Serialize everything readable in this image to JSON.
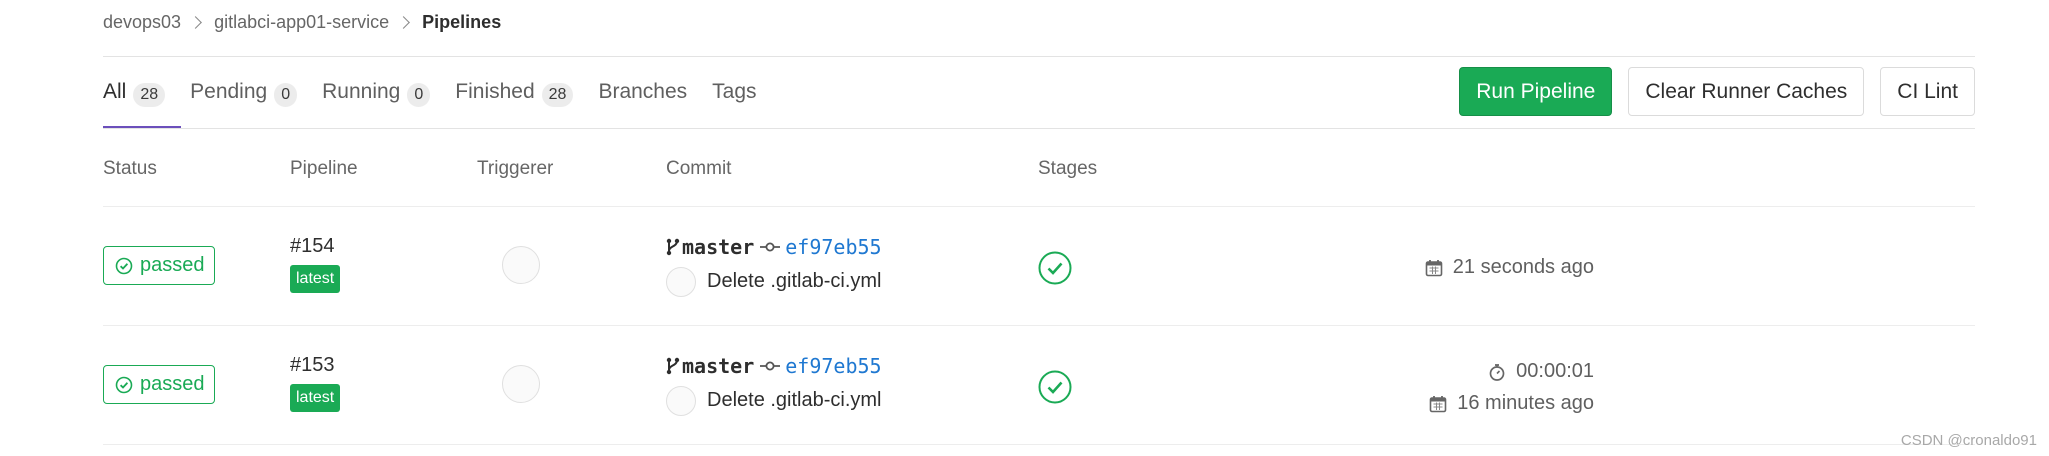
{
  "breadcrumb": {
    "group": "devops03",
    "project": "gitlabci-app01-service",
    "current": "Pipelines"
  },
  "tabs": [
    {
      "label": "All",
      "count": "28",
      "active": true
    },
    {
      "label": "Pending",
      "count": "0"
    },
    {
      "label": "Running",
      "count": "0"
    },
    {
      "label": "Finished",
      "count": "28"
    },
    {
      "label": "Branches"
    },
    {
      "label": "Tags"
    }
  ],
  "actions": {
    "run_pipeline": "Run Pipeline",
    "clear_caches": "Clear Runner Caches",
    "ci_lint": "CI Lint"
  },
  "table": {
    "headers": {
      "status": "Status",
      "pipeline": "Pipeline",
      "triggerer": "Triggerer",
      "commit": "Commit",
      "stages": "Stages"
    },
    "rows": [
      {
        "status": "passed",
        "pipeline_id": "#154",
        "badge": "latest",
        "branch": "master",
        "sha": "ef97eb55",
        "message": "Delete .gitlab-ci.yml",
        "finished": "21 seconds ago"
      },
      {
        "status": "passed",
        "pipeline_id": "#153",
        "badge": "latest",
        "branch": "master",
        "sha": "ef97eb55",
        "message": "Delete .gitlab-ci.yml",
        "duration": "00:00:01",
        "finished": "16 minutes ago"
      }
    ]
  },
  "colors": {
    "success": "#1aaa55",
    "active_tab": "#6b4fbb",
    "link": "#1f78d1"
  },
  "watermark": "CSDN @cronaldo91"
}
